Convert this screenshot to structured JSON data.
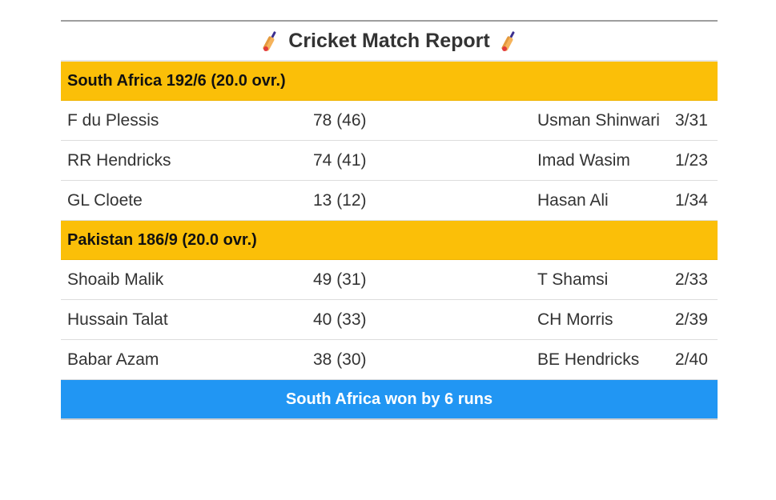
{
  "report": {
    "title": "Cricket Match Report",
    "title_icon": "cricket-bat-icon",
    "innings": [
      {
        "header": "South Africa 192/6 (20.0 ovr.)",
        "rows": [
          {
            "batsman": "F du Plessis",
            "score": "78 (46)",
            "bowler": "Usman Shinwari",
            "figures": "3/31"
          },
          {
            "batsman": "RR Hendricks",
            "score": "74 (41)",
            "bowler": "Imad Wasim",
            "figures": "1/23"
          },
          {
            "batsman": "GL Cloete",
            "score": "13 (12)",
            "bowler": "Hasan Ali",
            "figures": "1/34"
          }
        ]
      },
      {
        "header": "Pakistan 186/9 (20.0 ovr.)",
        "rows": [
          {
            "batsman": "Shoaib Malik",
            "score": "49 (31)",
            "bowler": "T Shamsi",
            "figures": "2/33"
          },
          {
            "batsman": "Hussain Talat",
            "score": "40 (33)",
            "bowler": "CH Morris",
            "figures": "2/39"
          },
          {
            "batsman": "Babar Azam",
            "score": "38 (30)",
            "bowler": "BE Hendricks",
            "figures": "2/40"
          }
        ]
      }
    ],
    "result": "South Africa won by 6 runs",
    "colors": {
      "team_header_bg": "#fbbf08",
      "result_bg": "#2196f3"
    }
  }
}
